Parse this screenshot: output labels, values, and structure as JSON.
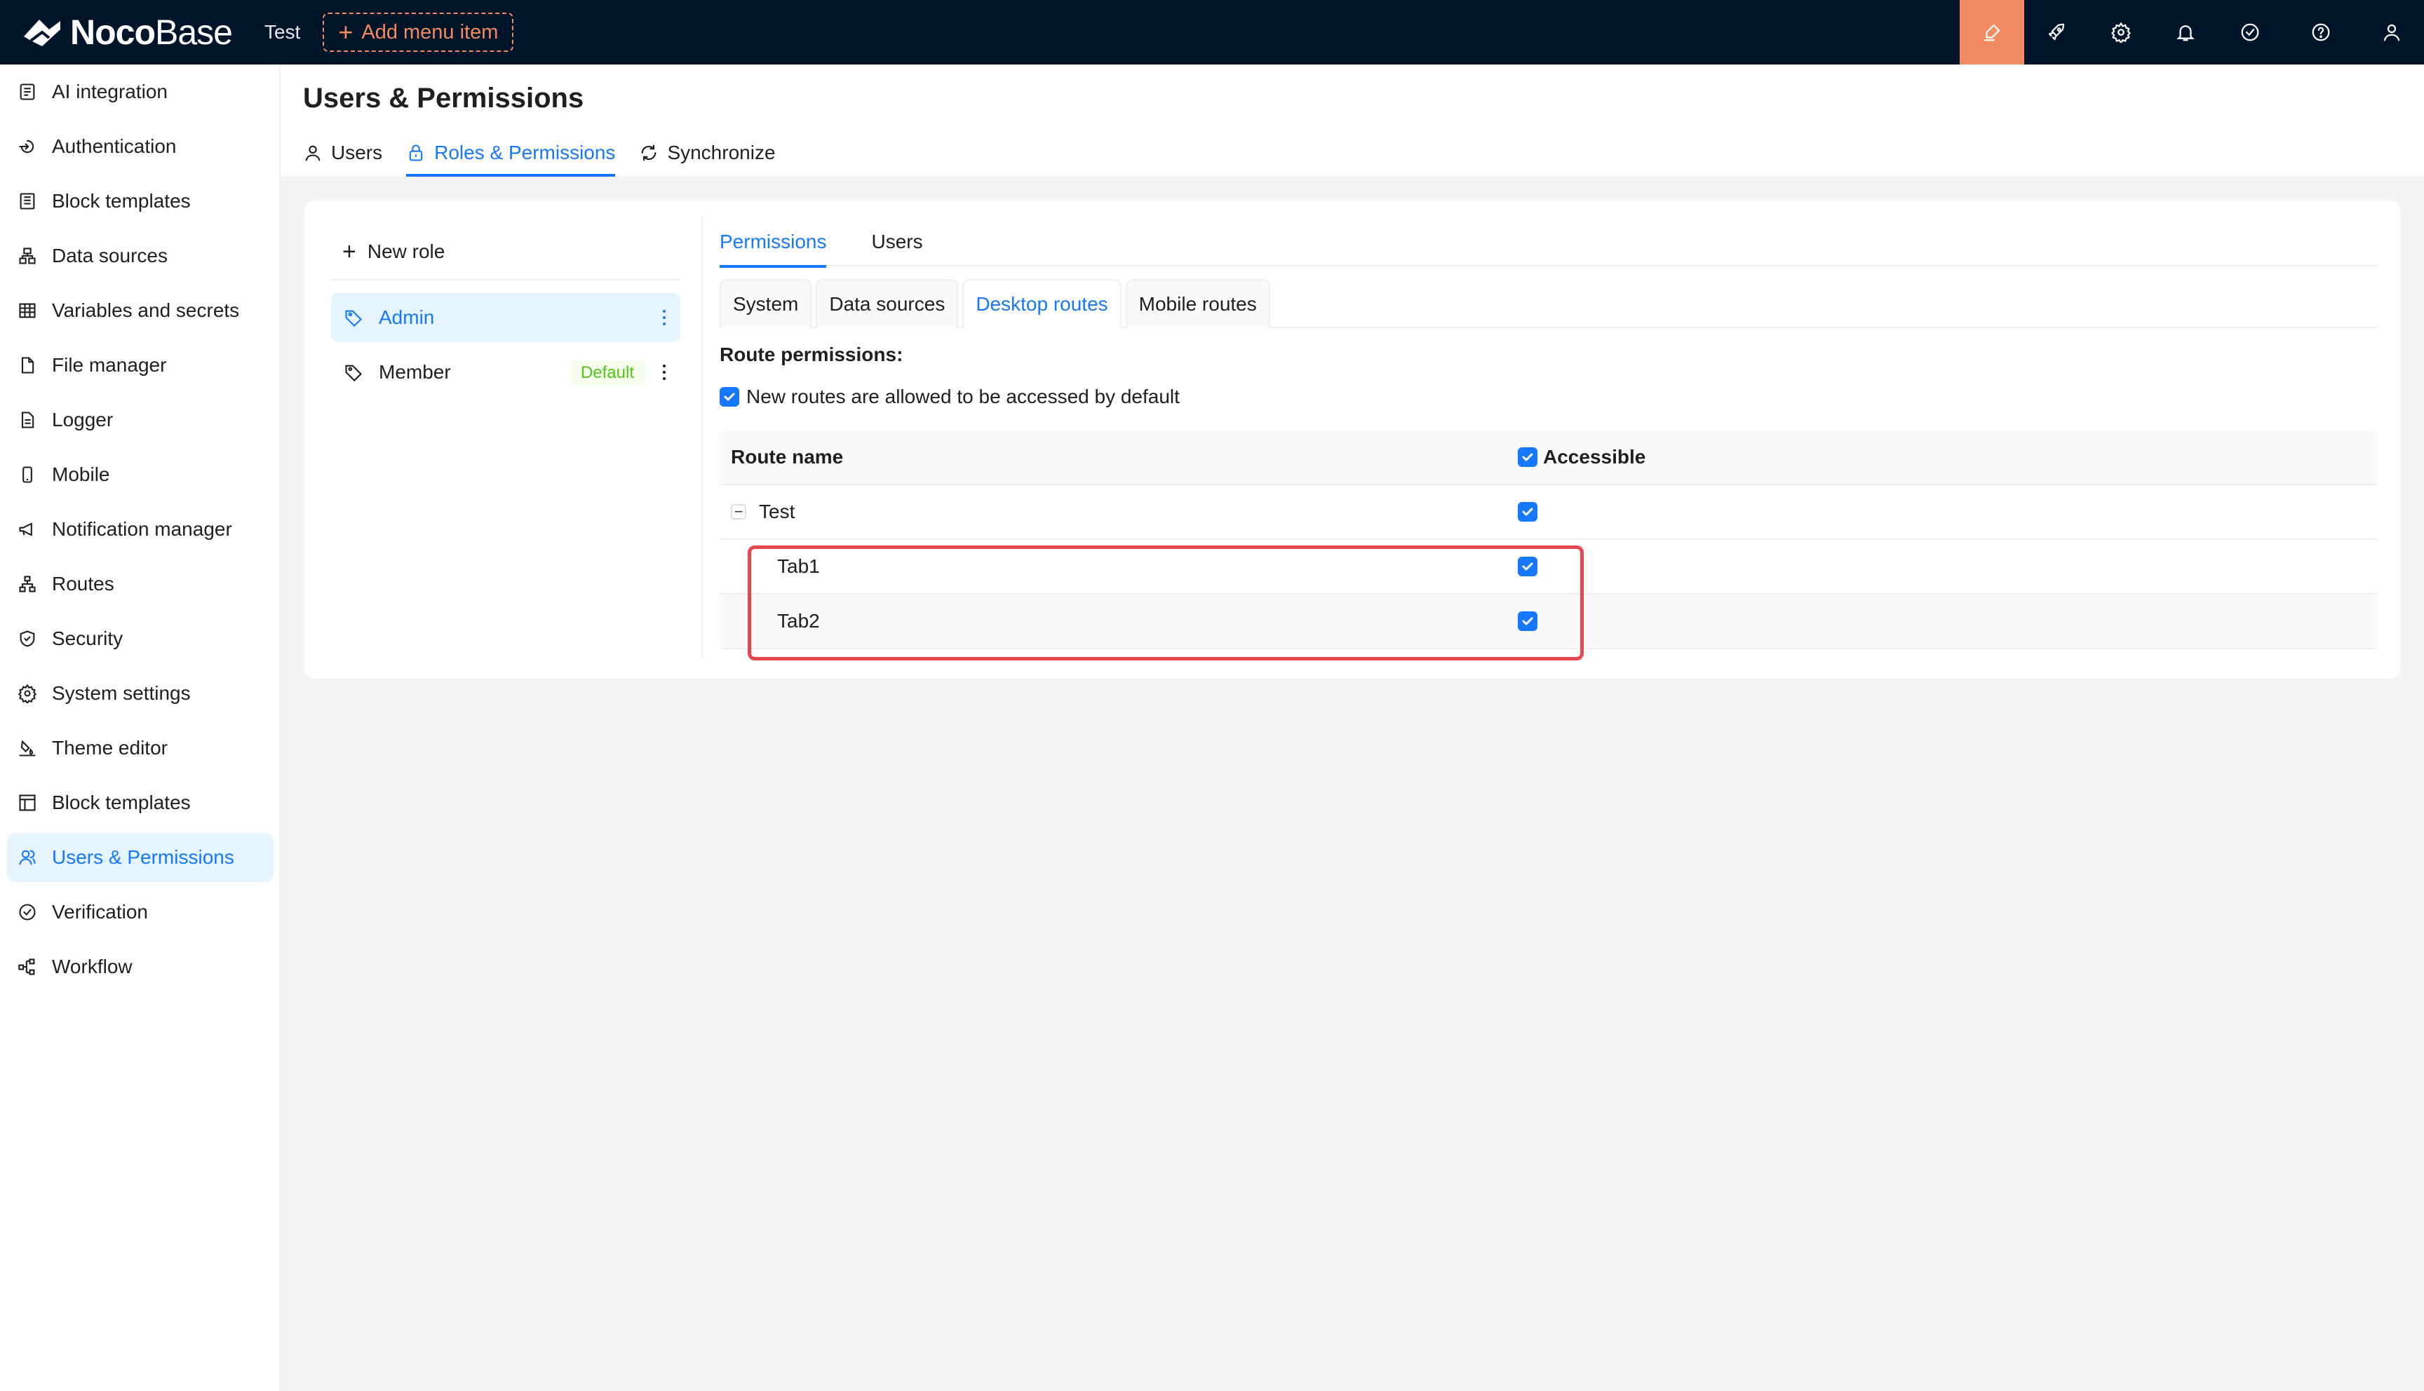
{
  "topbar": {
    "logo_noco": "Noco",
    "logo_base": "Base",
    "menu_test": "Test",
    "add_menu_item": "Add menu item",
    "icons": [
      "highlighter-icon",
      "rocket-icon",
      "gear-icon",
      "bell-icon",
      "check-circle-icon",
      "help-icon",
      "user-icon"
    ],
    "accent_color": "#f18b62"
  },
  "sidebar": {
    "items": [
      {
        "label": "AI integration",
        "icon": "ai-icon"
      },
      {
        "label": "Authentication",
        "icon": "login-icon"
      },
      {
        "label": "Block templates",
        "icon": "block-template-icon"
      },
      {
        "label": "Data sources",
        "icon": "database-icon"
      },
      {
        "label": "Variables and secrets",
        "icon": "table-icon"
      },
      {
        "label": "File manager",
        "icon": "file-icon"
      },
      {
        "label": "Logger",
        "icon": "logger-icon"
      },
      {
        "label": "Mobile",
        "icon": "mobile-icon"
      },
      {
        "label": "Notification manager",
        "icon": "megaphone-icon"
      },
      {
        "label": "Routes",
        "icon": "routes-icon"
      },
      {
        "label": "Security",
        "icon": "shield-icon"
      },
      {
        "label": "System settings",
        "icon": "gear-icon"
      },
      {
        "label": "Theme editor",
        "icon": "theme-icon"
      },
      {
        "label": "Block templates",
        "icon": "layout-icon"
      },
      {
        "label": "Users & Permissions",
        "icon": "users-icon",
        "active": true
      },
      {
        "label": "Verification",
        "icon": "check-circle-icon"
      },
      {
        "label": "Workflow",
        "icon": "workflow-icon"
      }
    ]
  },
  "main": {
    "title": "Users & Permissions",
    "tabs": [
      {
        "label": "Users"
      },
      {
        "label": "Roles & Permissions",
        "active": true
      },
      {
        "label": "Synchronize"
      }
    ]
  },
  "roles": {
    "new_role": "New role",
    "items": [
      {
        "label": "Admin",
        "active": true
      },
      {
        "label": "Member",
        "badge": "Default"
      }
    ]
  },
  "permissions": {
    "tabs": [
      "Permissions",
      "Users"
    ],
    "subtabs": [
      "System",
      "Data sources",
      "Desktop routes",
      "Mobile routes"
    ],
    "route_label": "Route permissions",
    "route_label_colon": ":",
    "new_routes_text": "New routes are allowed to be accessed by default",
    "new_routes_checked": true,
    "table": {
      "col_route": "Route name",
      "col_access": "Accessible",
      "rows": [
        {
          "name": "Test",
          "accessible": true,
          "expandable": true
        },
        {
          "name": "Tab1",
          "accessible": true
        },
        {
          "name": "Tab2",
          "accessible": true
        }
      ]
    },
    "highlight_color": "#e5484d"
  }
}
